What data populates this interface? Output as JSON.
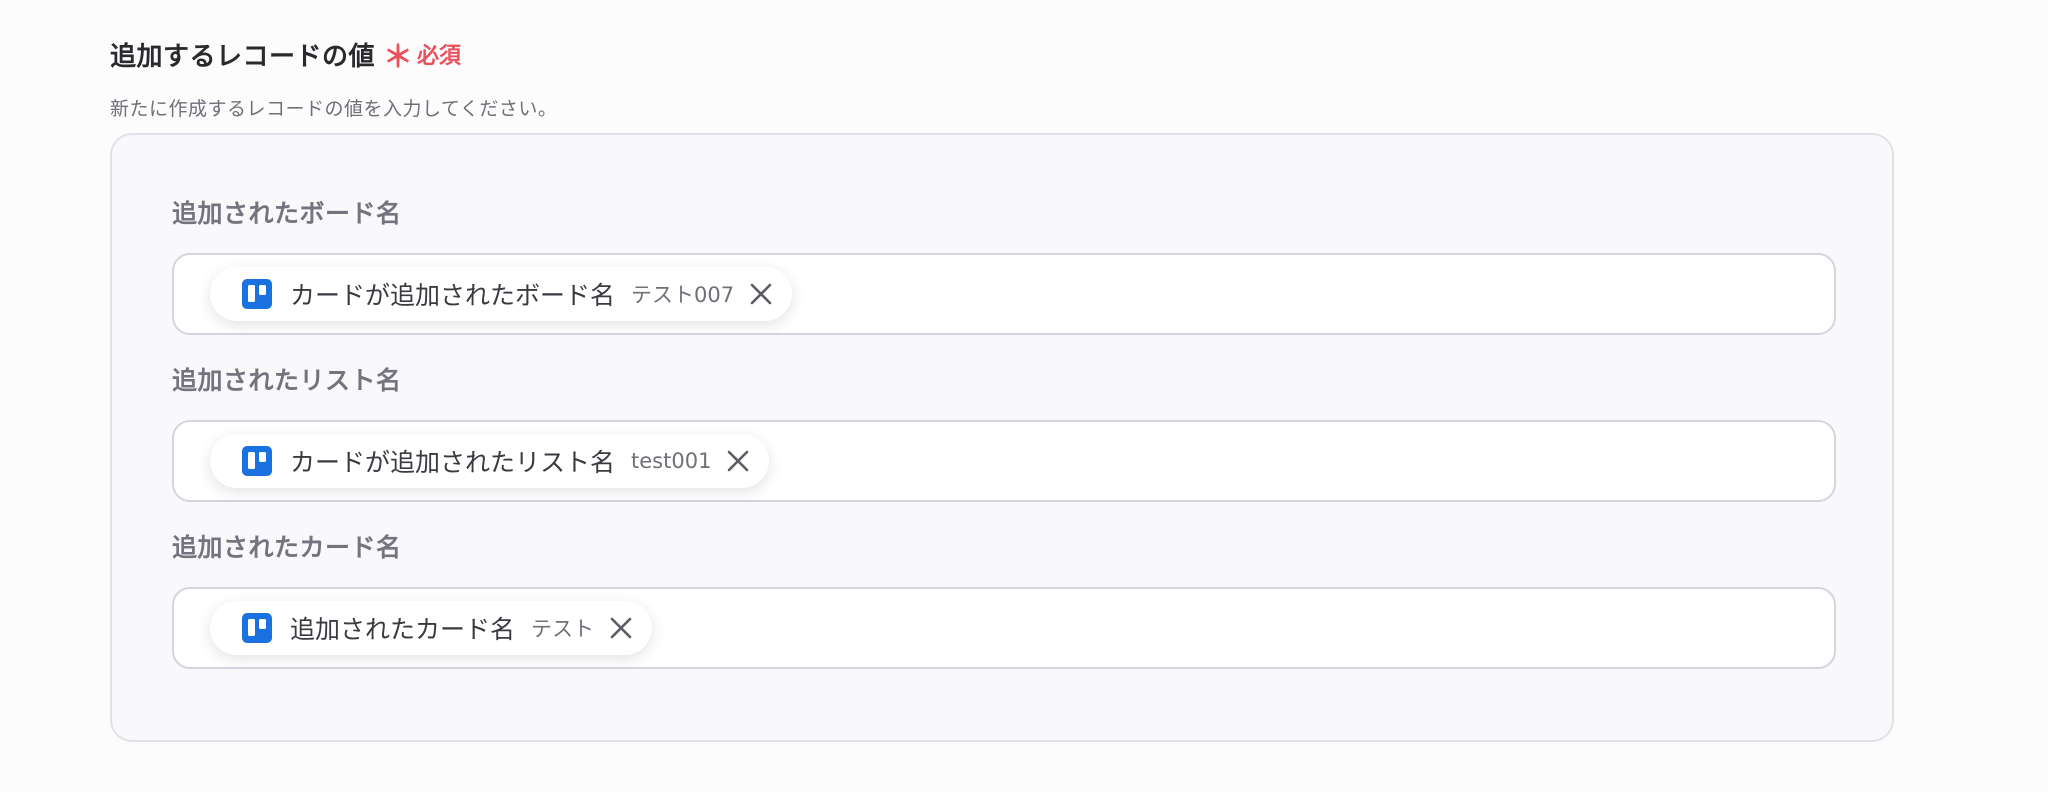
{
  "section": {
    "title": "追加するレコードの値",
    "required_star": "＊",
    "required_label": "必須",
    "description": "新たに作成するレコードの値を入力してください。"
  },
  "fields": [
    {
      "label": "追加されたボード名",
      "chip": {
        "icon": "trello-icon",
        "label": "カードが追加されたボード名",
        "value": "テスト007"
      }
    },
    {
      "label": "追加されたリスト名",
      "chip": {
        "icon": "trello-icon",
        "label": "カードが追加されたリスト名",
        "value": "test001"
      }
    },
    {
      "label": "追加されたカード名",
      "chip": {
        "icon": "trello-icon",
        "label": "追加されたカード名",
        "value": "テスト"
      }
    }
  ],
  "colors": {
    "required": "#e8525d",
    "trello_blue": "#1972e0",
    "panel_bg": "#f9f8fa"
  }
}
